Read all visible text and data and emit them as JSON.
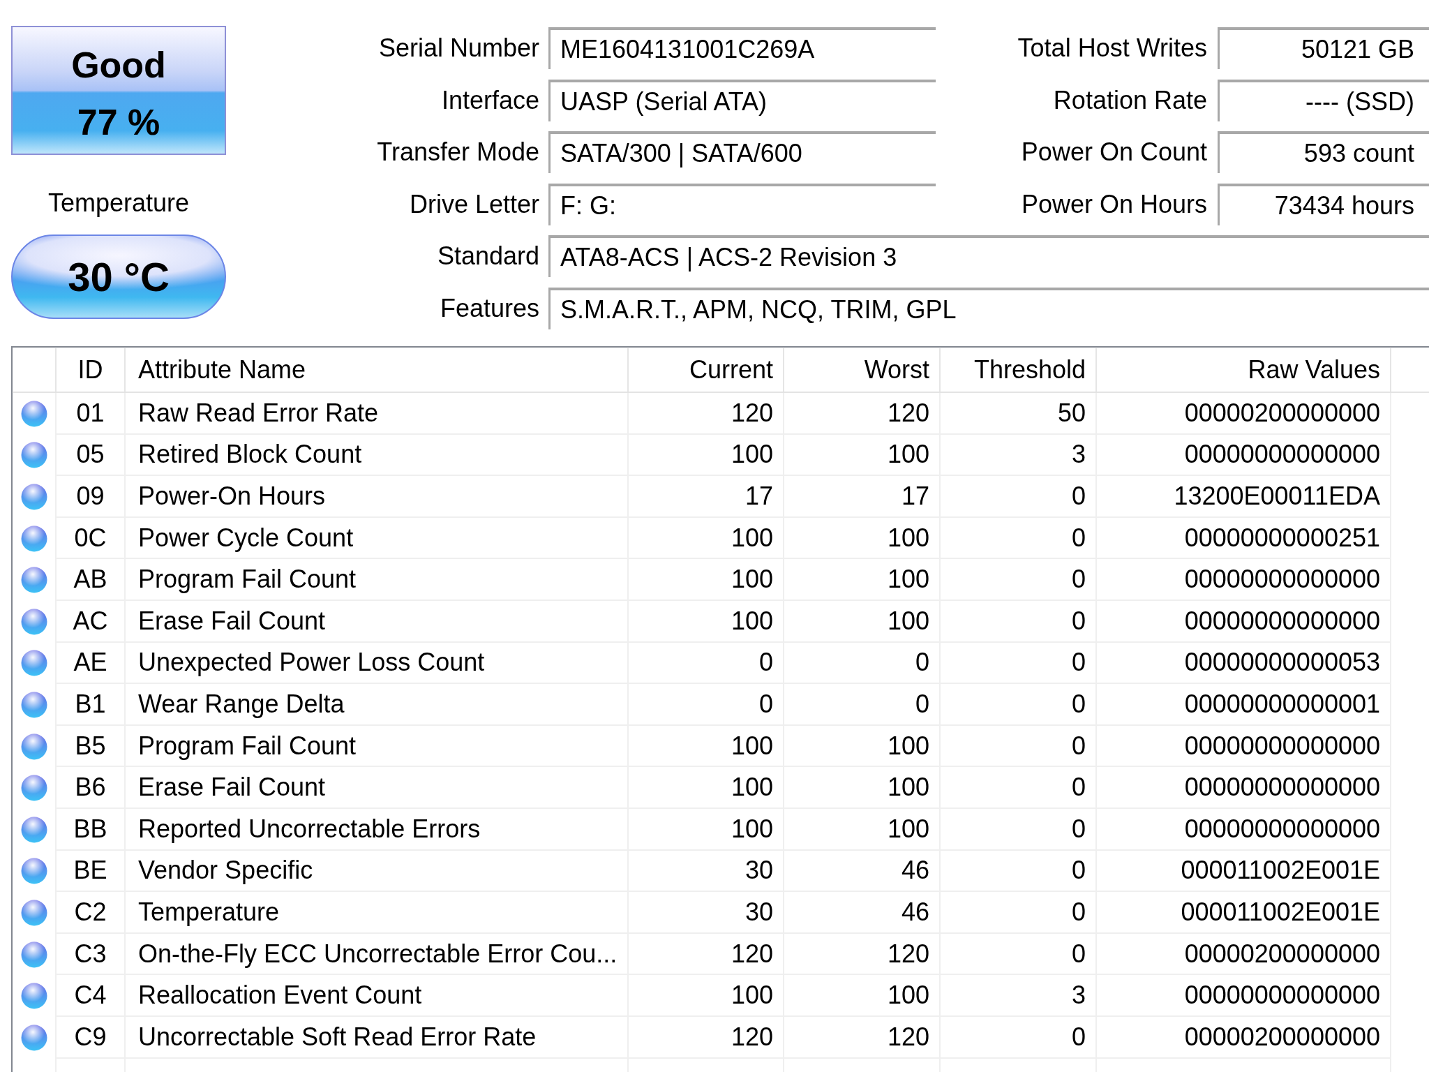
{
  "health_status": {
    "condition": "Good",
    "percent": "77 %"
  },
  "temperature": {
    "label": "Temperature",
    "value": "30 °C"
  },
  "drive_info": [
    {
      "fields": [
        {
          "label": "Serial Number",
          "value": "ME1604131001C269A"
        },
        {
          "label": "Total Host Writes",
          "value": "50121 GB"
        }
      ]
    },
    {
      "fields": [
        {
          "label": "Interface",
          "value": "UASP (Serial ATA)"
        },
        {
          "label": "Rotation Rate",
          "value": "---- (SSD)"
        }
      ]
    },
    {
      "fields": [
        {
          "label": "Transfer Mode",
          "value": "SATA/300 | SATA/600"
        },
        {
          "label": "Power On Count",
          "value": "593 count"
        }
      ]
    },
    {
      "fields": [
        {
          "label": "Drive Letter",
          "value": "F: G:"
        },
        {
          "label": "Power On Hours",
          "value": "73434 hours"
        }
      ]
    },
    {
      "fields": [
        {
          "label": "Standard",
          "value": "ATA8-ACS | ACS-2 Revision 3"
        }
      ]
    },
    {
      "fields": [
        {
          "label": "Features",
          "value": "S.M.A.R.T., APM, NCQ, TRIM, GPL"
        }
      ]
    }
  ],
  "table": {
    "columns": [
      "ID",
      "Attribute Name",
      "Current",
      "Worst",
      "Threshold",
      "Raw Values"
    ],
    "rows": [
      {
        "id": "01",
        "name": "Raw Read Error Rate",
        "current": "120",
        "worst": "120",
        "threshold": "50",
        "raw": "00000200000000"
      },
      {
        "id": "05",
        "name": "Retired Block Count",
        "current": "100",
        "worst": "100",
        "threshold": "3",
        "raw": "00000000000000"
      },
      {
        "id": "09",
        "name": "Power-On Hours",
        "current": "17",
        "worst": "17",
        "threshold": "0",
        "raw": "13200E00011EDA"
      },
      {
        "id": "0C",
        "name": "Power Cycle Count",
        "current": "100",
        "worst": "100",
        "threshold": "0",
        "raw": "00000000000251"
      },
      {
        "id": "AB",
        "name": "Program Fail Count",
        "current": "100",
        "worst": "100",
        "threshold": "0",
        "raw": "00000000000000"
      },
      {
        "id": "AC",
        "name": "Erase Fail Count",
        "current": "100",
        "worst": "100",
        "threshold": "0",
        "raw": "00000000000000"
      },
      {
        "id": "AE",
        "name": "Unexpected Power Loss Count",
        "current": "0",
        "worst": "0",
        "threshold": "0",
        "raw": "00000000000053"
      },
      {
        "id": "B1",
        "name": "Wear Range Delta",
        "current": "0",
        "worst": "0",
        "threshold": "0",
        "raw": "00000000000001"
      },
      {
        "id": "B5",
        "name": "Program Fail Count",
        "current": "100",
        "worst": "100",
        "threshold": "0",
        "raw": "00000000000000"
      },
      {
        "id": "B6",
        "name": "Erase Fail Count",
        "current": "100",
        "worst": "100",
        "threshold": "0",
        "raw": "00000000000000"
      },
      {
        "id": "BB",
        "name": "Reported Uncorrectable Errors",
        "current": "100",
        "worst": "100",
        "threshold": "0",
        "raw": "00000000000000"
      },
      {
        "id": "BE",
        "name": "Vendor Specific",
        "current": "30",
        "worst": "46",
        "threshold": "0",
        "raw": "000011002E001E"
      },
      {
        "id": "C2",
        "name": "Temperature",
        "current": "30",
        "worst": "46",
        "threshold": "0",
        "raw": "000011002E001E"
      },
      {
        "id": "C3",
        "name": "On-the-Fly ECC Uncorrectable Error Cou...",
        "current": "120",
        "worst": "120",
        "threshold": "0",
        "raw": "00000200000000"
      },
      {
        "id": "C4",
        "name": "Reallocation Event Count",
        "current": "100",
        "worst": "100",
        "threshold": "3",
        "raw": "00000000000000"
      },
      {
        "id": "C9",
        "name": "Uncorrectable Soft Read Error Rate",
        "current": "120",
        "worst": "120",
        "threshold": "0",
        "raw": "00000200000000"
      }
    ]
  }
}
